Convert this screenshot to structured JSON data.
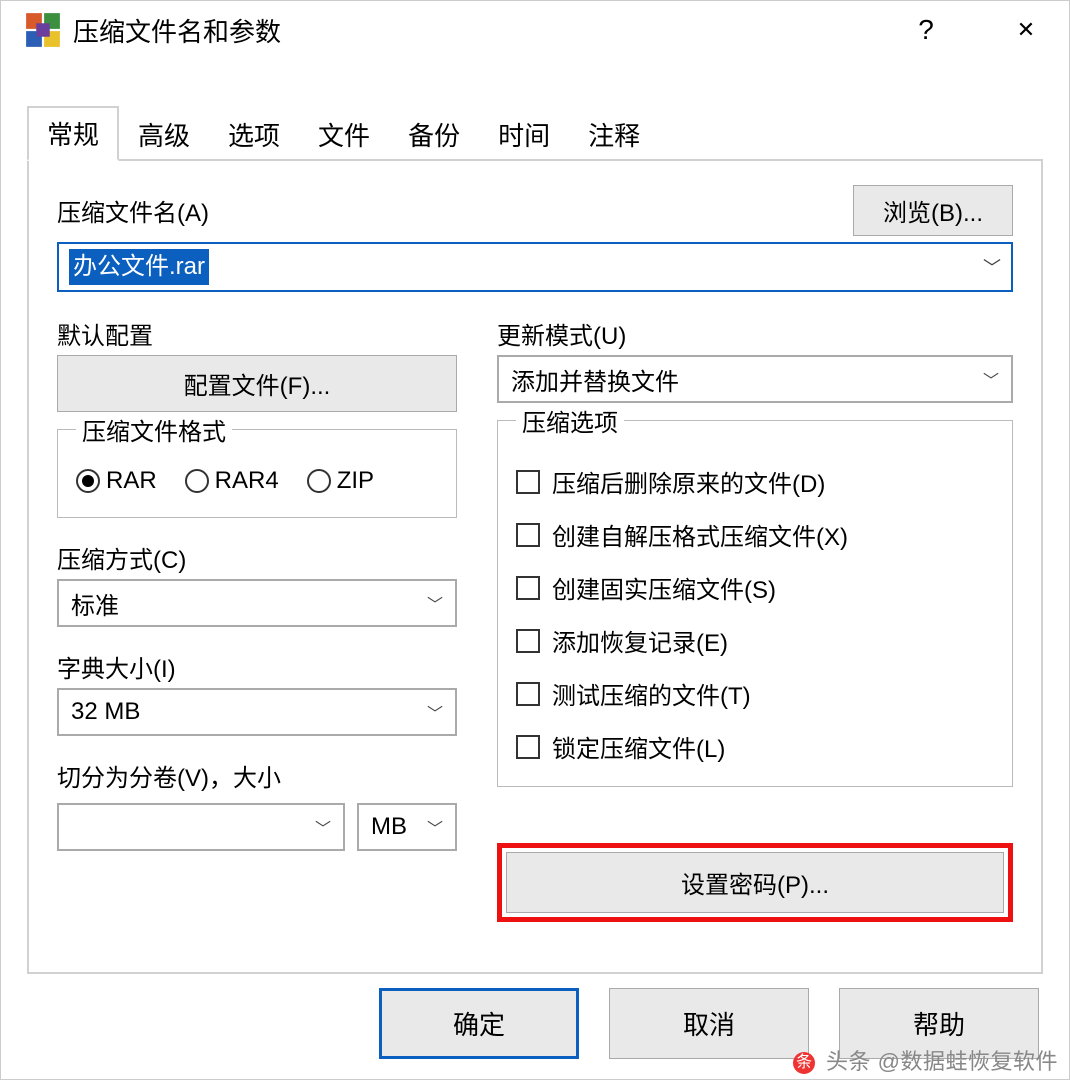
{
  "window": {
    "title": "压缩文件名和参数",
    "help": "?",
    "close": "✕"
  },
  "tabs": [
    "常规",
    "高级",
    "选项",
    "文件",
    "备份",
    "时间",
    "注释"
  ],
  "archive": {
    "name_label": "压缩文件名(A)",
    "browse_btn": "浏览(B)...",
    "value": "办公文件.rar"
  },
  "profile": {
    "label": "默认配置",
    "button": "配置文件(F)..."
  },
  "update_mode": {
    "label": "更新模式(U)",
    "value": "添加并替换文件"
  },
  "format": {
    "label": "压缩文件格式",
    "options": [
      "RAR",
      "RAR4",
      "ZIP"
    ],
    "selected": 0
  },
  "method": {
    "label": "压缩方式(C)",
    "value": "标准"
  },
  "dict": {
    "label": "字典大小(I)",
    "value": "32 MB"
  },
  "split": {
    "label": "切分为分卷(V)，大小",
    "value": "",
    "unit": "MB"
  },
  "options": {
    "label": "压缩选项",
    "items": [
      "压缩后删除原来的文件(D)",
      "创建自解压格式压缩文件(X)",
      "创建固实压缩文件(S)",
      "添加恢复记录(E)",
      "测试压缩的文件(T)",
      "锁定压缩文件(L)"
    ]
  },
  "password_btn": "设置密码(P)...",
  "footer": {
    "ok": "确定",
    "cancel": "取消",
    "help": "帮助"
  },
  "watermark": "头条 @数据蛙恢复软件"
}
